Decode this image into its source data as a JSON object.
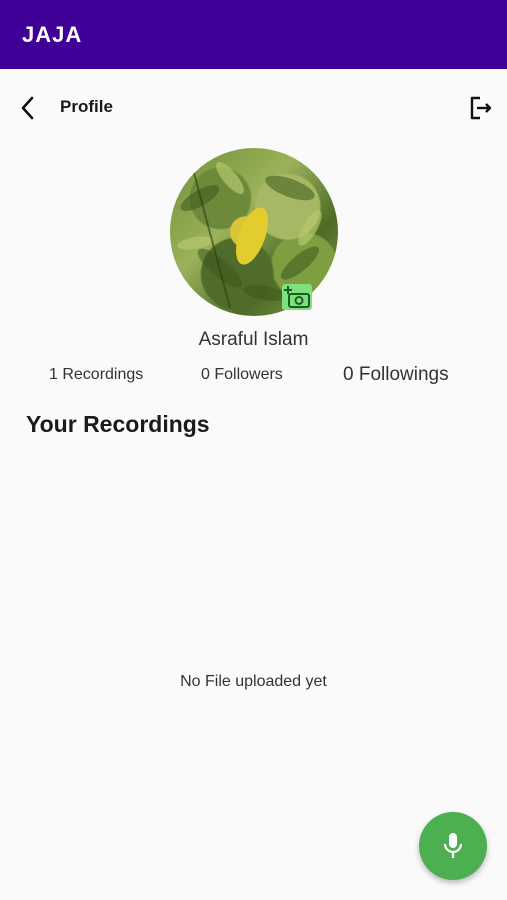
{
  "app": {
    "title": "JAJA"
  },
  "toolbar": {
    "title": "Profile",
    "back_icon": "chevron-left-icon",
    "logout_icon": "logout-icon"
  },
  "profile": {
    "name": "Asraful Islam",
    "camera_icon": "add-photo-icon",
    "stats": {
      "recordings": "1 Recordings",
      "followers": "0 Followers",
      "followings": "0 Followings"
    }
  },
  "recordings": {
    "title": "Your Recordings",
    "empty_message": "No File uploaded yet"
  },
  "fab": {
    "icon": "microphone-icon"
  },
  "colors": {
    "appbar": "#3f0097",
    "fab": "#4caf50",
    "camera_badge": "#7ee07e"
  }
}
